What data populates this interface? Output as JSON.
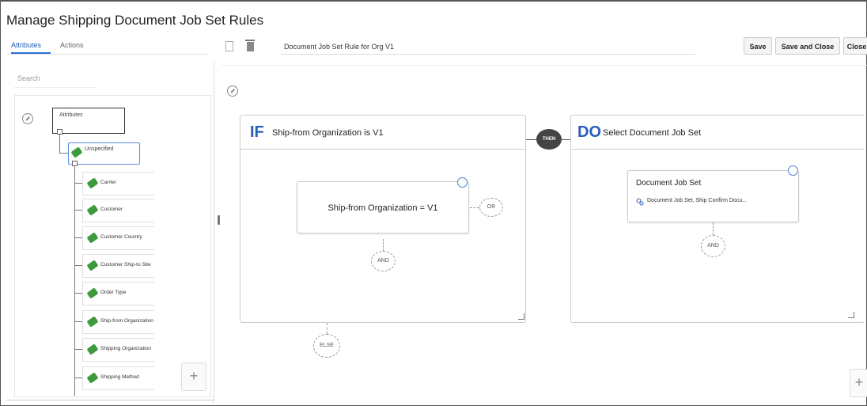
{
  "page_title": "Manage Shipping Document Job Set Rules",
  "tabs": [
    {
      "label": "Attributes",
      "active": true
    },
    {
      "label": "Actions",
      "active": false
    }
  ],
  "search_placeholder": "Search",
  "tree": {
    "root_label": "Attributes",
    "selected_label": "Unspecified",
    "leaves": [
      "Carrier",
      "Customer",
      "Customer Country",
      "Customer Ship-to Site",
      "Order Type",
      "Ship-from Organization",
      "Shipping Organization",
      "Shipping Method"
    ]
  },
  "toolbar": {
    "rule_name": "Document Job Set Rule for Org V1",
    "save_label": "Save",
    "save_close_label": "Save and Close",
    "close_label": "Close"
  },
  "rule": {
    "if_keyword": "IF",
    "if_header": "Ship-from Organization is V1",
    "condition": "Ship-from Organization = V1",
    "or_label": "OR",
    "and_label": "AND",
    "else_label": "ELSE",
    "then_label": "THEN",
    "do_keyword": "DO",
    "do_header": "Select Document Job Set",
    "action_title": "Document Job Set",
    "action_detail": "Document Job Set, Ship Confirm Docu...",
    "action_and_label": "AND"
  },
  "colors": {
    "accent": "#2a5fb8",
    "tag_green": "#3d9a3d"
  }
}
